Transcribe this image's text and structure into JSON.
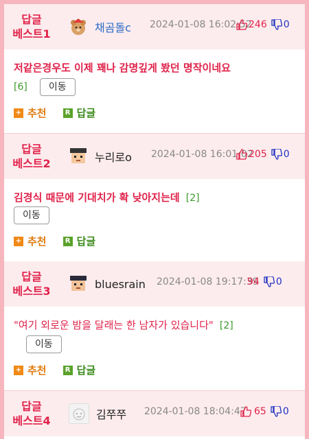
{
  "posts": [
    {
      "rank_line1": "답글",
      "rank_line2": "베스트1",
      "author": "채곰돌c",
      "date": "2024-01-08 16:02:52",
      "likes": "246",
      "dislikes": "0",
      "title": "저같은경우도 이제 꽤나 감명깊게 봤던 명작이네요",
      "comment_count": "[6]",
      "move_label": "이동",
      "recommend_label": "추천",
      "reply_label": "답글"
    },
    {
      "rank_line1": "답글",
      "rank_line2": "베스트2",
      "author": "누리로o",
      "date": "2024-01-08 16:01:02",
      "likes": "205",
      "dislikes": "0",
      "title": "김경식 때문에 기대치가 확 낮아지는데",
      "comment_count": "[2]",
      "move_label": "이동",
      "recommend_label": "추천",
      "reply_label": "답글"
    },
    {
      "rank_line1": "답글",
      "rank_line2": "베스트3",
      "author": "bluesrain",
      "date": "2024-01-08 19:17:39",
      "likes": "94",
      "dislikes": "0",
      "title": "\"여기 외로운 밤을 달래는 한 남자가 있습니다\"",
      "comment_count": "[2]",
      "move_label": "이동",
      "recommend_label": "추천",
      "reply_label": "답글"
    },
    {
      "rank_line1": "답글",
      "rank_line2": "베스트4",
      "author": "김쭈쭈",
      "date": "2024-01-08 18:04:47",
      "likes": "65",
      "dislikes": "0"
    }
  ],
  "icons": {
    "like": "thumbs-up-icon",
    "dislike": "thumbs-down-icon",
    "recommend": "plus-square-icon",
    "reply": "r-square-icon"
  },
  "colors": {
    "accent_red": "#e0224a",
    "border_pink": "#f7b6bd",
    "header_bg": "#fdecee",
    "reply_green": "#5aa22a",
    "recommend_orange": "#f08a17",
    "dislike_blue": "#2030c0"
  }
}
